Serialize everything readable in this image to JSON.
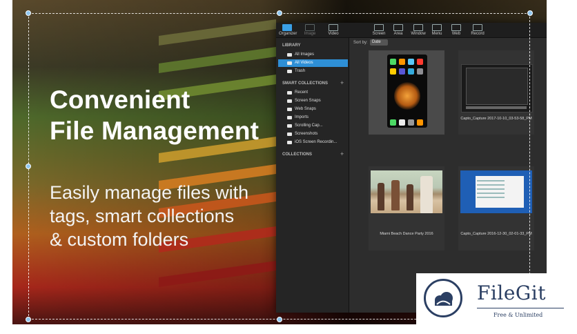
{
  "headline": {
    "line1": "Convenient",
    "line2": "File Management"
  },
  "tagline": {
    "line1": "Easily manage files with",
    "line2": "tags, smart collections",
    "line3": "& custom folders"
  },
  "toolbar": {
    "items": [
      {
        "label": "Organizer",
        "active": true
      },
      {
        "label": "Image",
        "active": false
      },
      {
        "label": "Video",
        "active": false
      },
      {
        "label": "Screen",
        "active": false
      },
      {
        "label": "Area",
        "active": false
      },
      {
        "label": "Window",
        "active": false
      },
      {
        "label": "Menu",
        "active": false
      },
      {
        "label": "Web",
        "active": false
      },
      {
        "label": "Record",
        "active": false
      }
    ]
  },
  "sidebar": {
    "library_header": "LIBRARY",
    "library_items": [
      {
        "label": "All Images",
        "selected": false
      },
      {
        "label": "All Videos",
        "selected": true
      },
      {
        "label": "Trash",
        "selected": false
      }
    ],
    "smart_header": "SMART COLLECTIONS",
    "smart_items": [
      {
        "label": "Recent"
      },
      {
        "label": "Screen Snaps"
      },
      {
        "label": "Web Snaps"
      },
      {
        "label": "Imports"
      },
      {
        "label": "Scrolling Cap..."
      },
      {
        "label": "Screenshots"
      },
      {
        "label": "iOS Screen Recordin..."
      }
    ],
    "collections_header": "COLLECTIONS",
    "plus": "+"
  },
  "sortbar": {
    "label": "Sort by:",
    "value": "Date"
  },
  "items": [
    {
      "caption": "",
      "selected": true
    },
    {
      "caption": "Capto_Capture 2017-10-10_03-53-58_PM",
      "selected": false
    },
    {
      "caption": "Miami Beach Dance Party 2016",
      "selected": false
    },
    {
      "caption": "Capto_Capture 2016-12-30_02-01-33_PM",
      "selected": false
    }
  ],
  "logo": {
    "name": "FileGit",
    "tagline": "Free & Unlimited"
  },
  "colors": {
    "accent": "#2e8fd6",
    "logo": "#2b3f63"
  }
}
